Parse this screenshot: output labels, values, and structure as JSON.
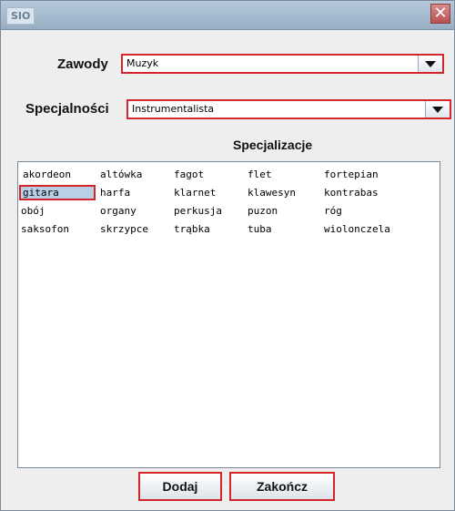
{
  "window": {
    "title_logo": "SIO",
    "close_glyph": "✕",
    "accent_color": "#d2262a"
  },
  "zawody": {
    "label": "Zawody",
    "selected": "Muzyk"
  },
  "specjalnosci": {
    "label": "Specjalności",
    "selected": "Instrumentalista"
  },
  "specjalizacje": {
    "title": "Specjalizacje",
    "items": [
      "akordeon",
      "altówka",
      "fagot",
      "flet",
      "fortepian",
      "gitara",
      "harfa",
      "klarnet",
      "klawesyn",
      "kontrabas",
      "obój",
      "organy",
      "perkusja",
      "puzon",
      "róg",
      "saksofon",
      "skrzypce",
      "trąbka",
      "tuba",
      "wiolonczela"
    ],
    "selected_item": "gitara"
  },
  "buttons": {
    "add": "Dodaj",
    "finish": "Zakończ"
  }
}
